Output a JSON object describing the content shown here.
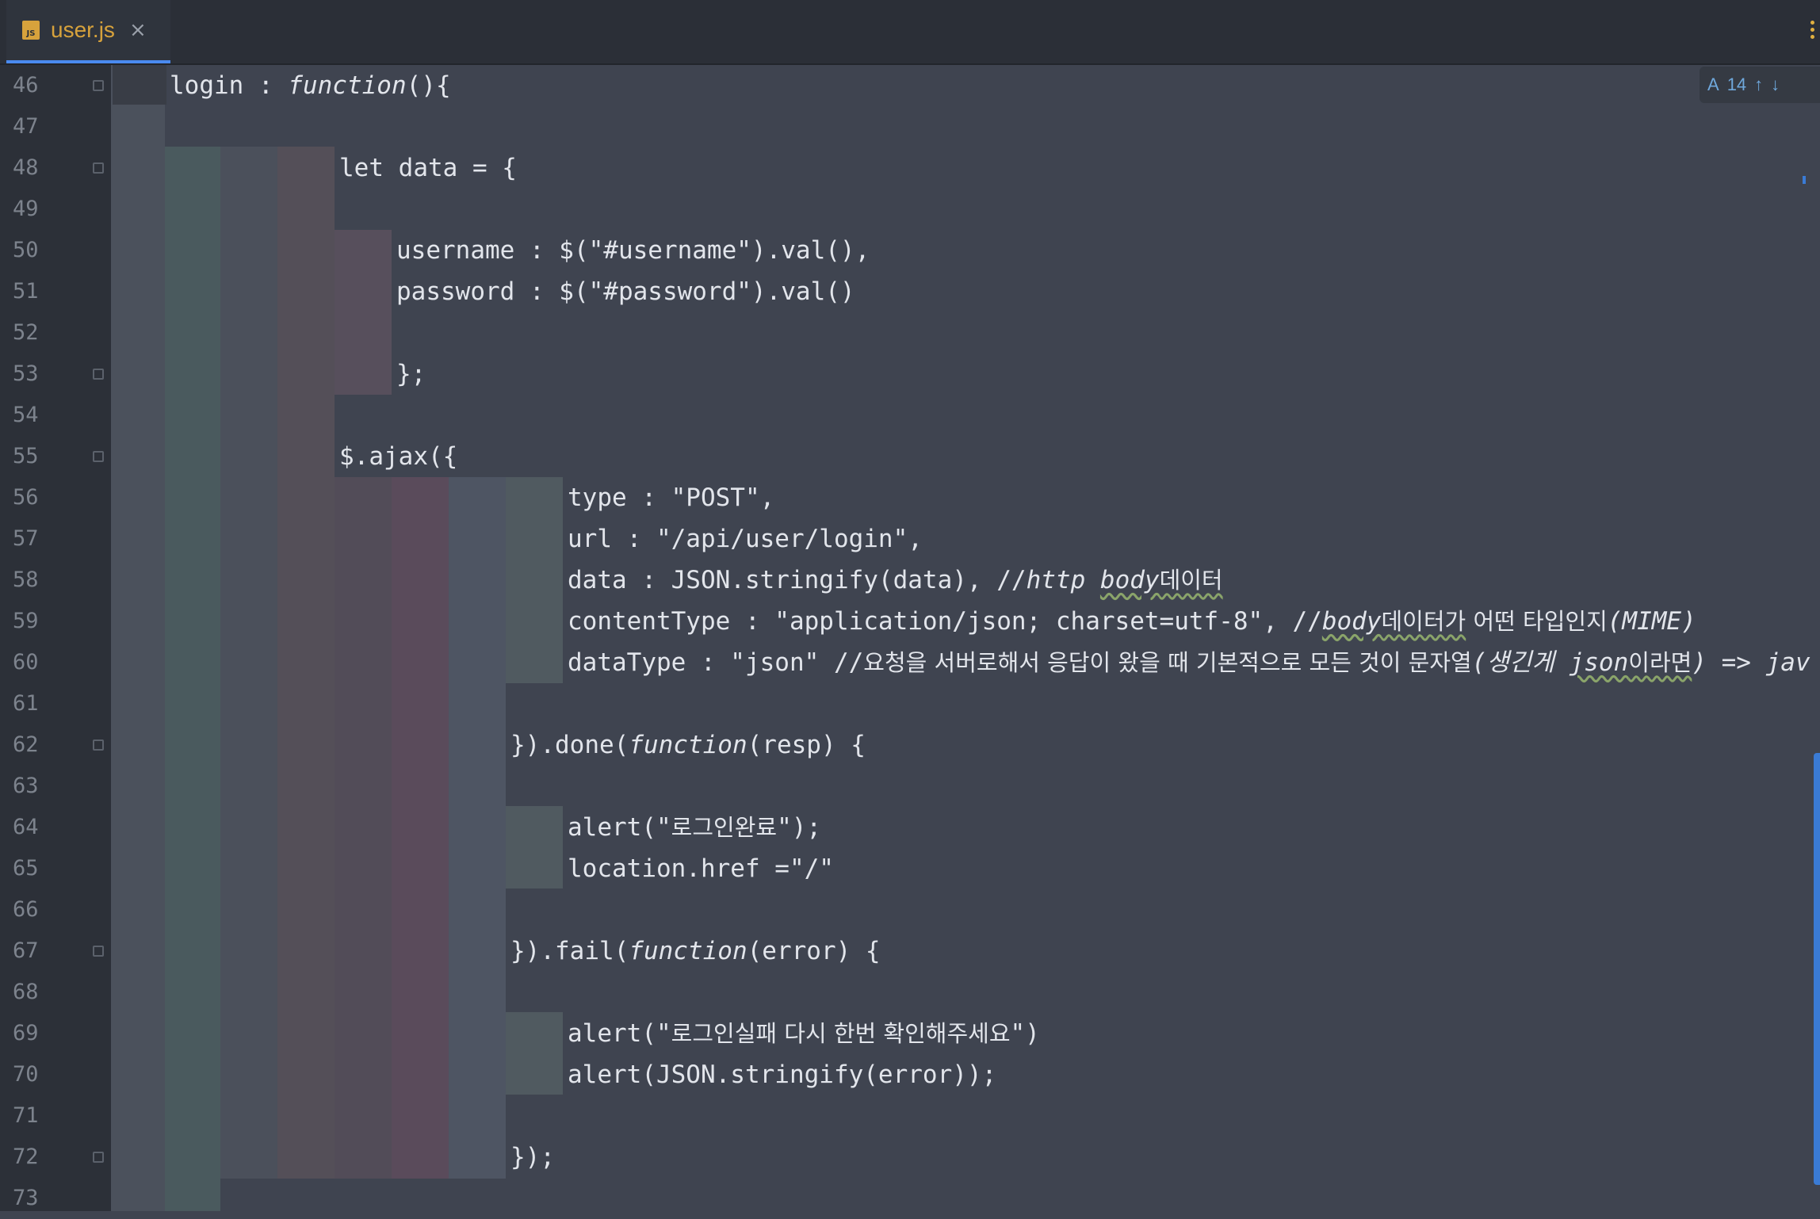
{
  "tab": {
    "icon_text": "JS",
    "filename": "user.js",
    "close_glyph": "×"
  },
  "inspection": {
    "count": "14",
    "up_glyph": "↑",
    "down_glyph": "↓",
    "icon_glyph": "A"
  },
  "line_numbers": [
    "46",
    "47",
    "48",
    "49",
    "50",
    "51",
    "52",
    "53",
    "54",
    "55",
    "56",
    "57",
    "58",
    "59",
    "60",
    "61",
    "62",
    "63",
    "64",
    "65",
    "66",
    "67",
    "68",
    "69",
    "70",
    "71",
    "72",
    "73"
  ],
  "code": {
    "l46_a": "login : ",
    "l46_fn": "function",
    "l46_b": "(){",
    "l48": "let data = {",
    "l50": "username : $(\"#username\").val(),",
    "l51": "password : $(\"#password\").val()",
    "l53": "};",
    "l55": "$.ajax({",
    "l56": "type : \"POST\",",
    "l57": "url : \"/api/user/login\",",
    "l58_a": "data : JSON.stringify(data), //",
    "l58_b": "http ",
    "l58_c": "body",
    "l58_d": "데이터",
    "l59_a": "contentType : \"application/json; charset=utf-8\", //",
    "l59_b": "body",
    "l59_c": "데이터가",
    "l59_d": " 어떤 타입인지",
    "l59_e": "(MIME)",
    "l60_a": "dataType : \"json\" //",
    "l60_b": "요청을 서버로해서 응답이 왔을 때 기본적으로 모든 것이 문자열",
    "l60_c": "(생긴게 ",
    "l60_d": "json",
    "l60_e": "이라면",
    "l60_f": ") => ",
    "l60_g": "jav",
    "l62_a": "}).done(",
    "l62_fn": "function",
    "l62_b": "(resp) {",
    "l64_a": "alert(\"",
    "l64_b": "로그인완료",
    "l64_c": "\");",
    "l65": "location.href =\"/\"",
    "l67_a": "}).fail(",
    "l67_fn": "function",
    "l67_b": "(error) {",
    "l69_a": "alert(\"",
    "l69_b": "로그인실패 다시 한번 확인해주세요",
    "l69_c": "\")",
    "l70": "alert(JSON.stringify(error));",
    "l72": "});"
  },
  "colors": {
    "editor_bg": "#3f4450",
    "gutter_bg": "#2c3038",
    "tab_accent": "#4a8af0",
    "js_icon": "#d7a23c"
  }
}
